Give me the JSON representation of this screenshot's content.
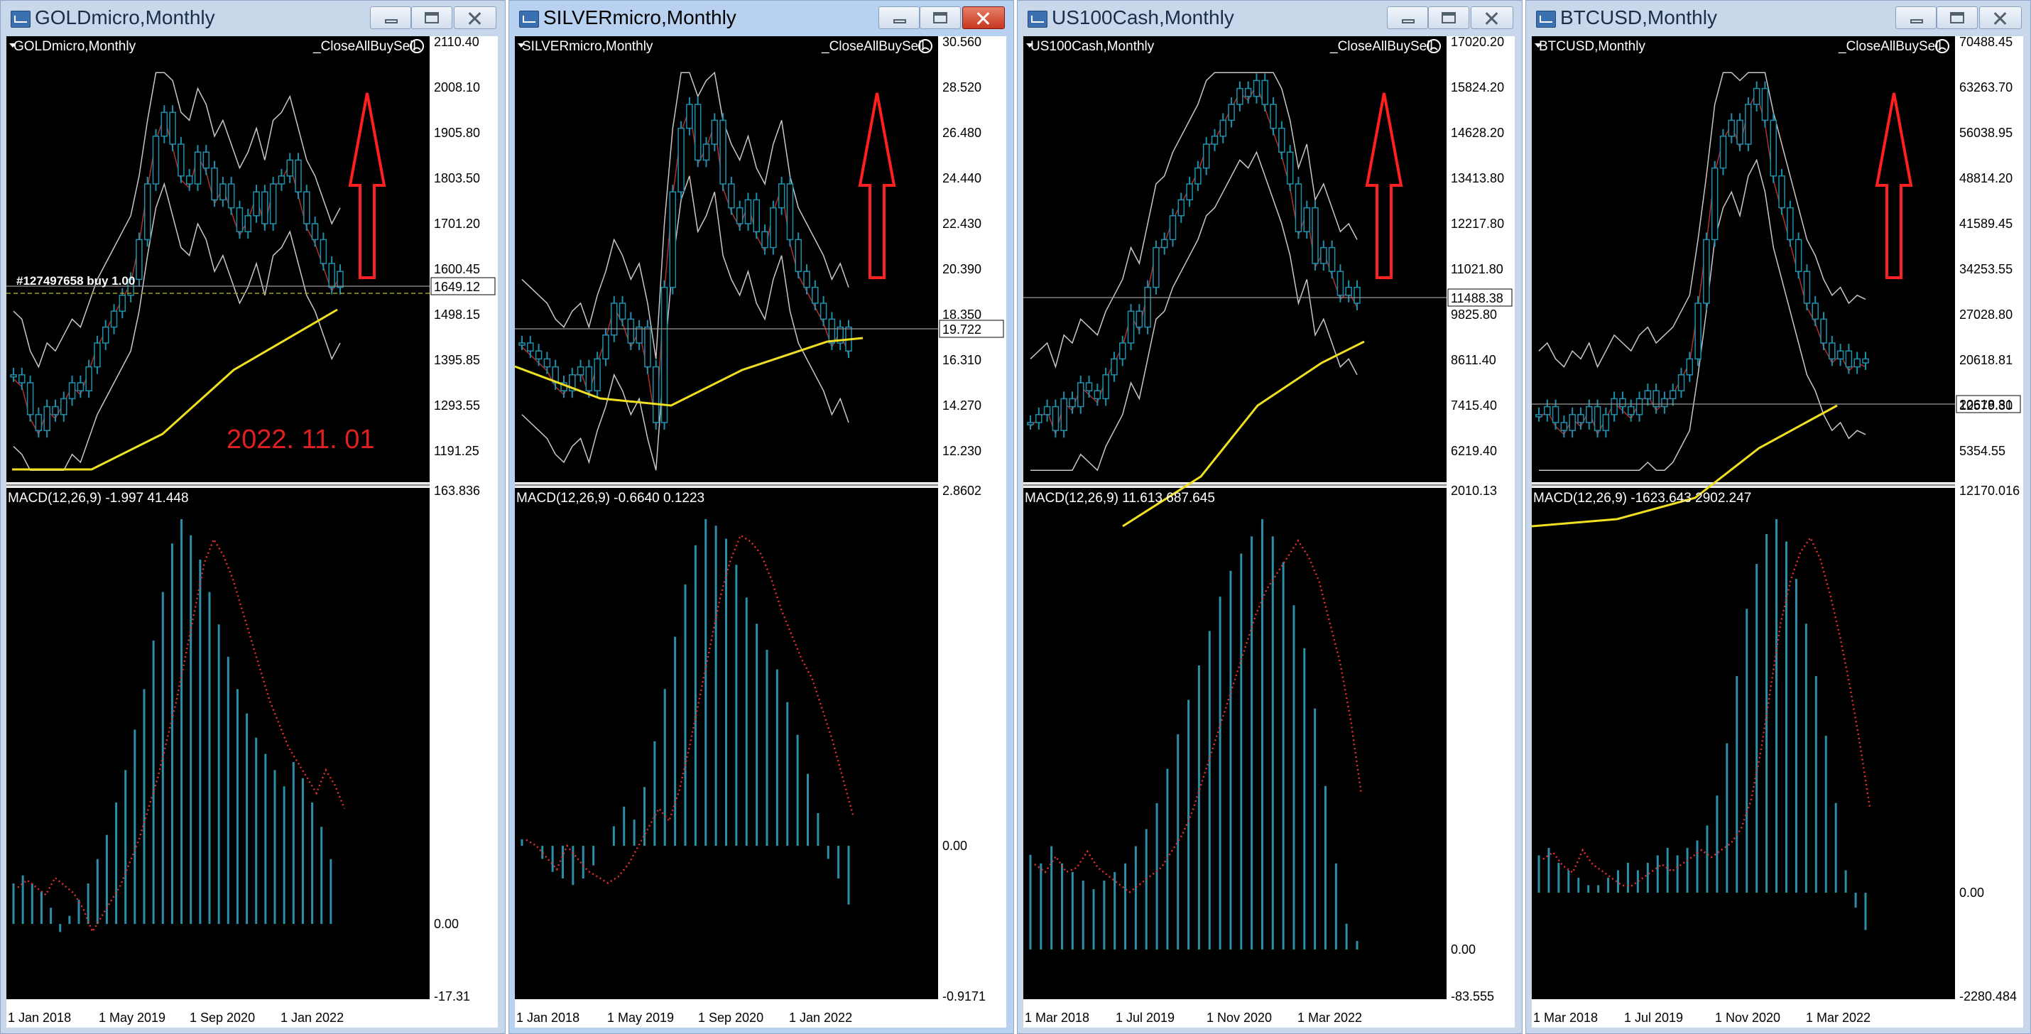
{
  "windows": [
    {
      "title": "GOLDmicro,Monthly",
      "active": false,
      "chart_label": "GOLDmicro,Monthly",
      "expert": "_CloseAllBuySell",
      "price_axis": [
        "2110.40",
        "2008.10",
        "1905.80",
        "1803.50",
        "1701.20",
        "1600.45",
        "1498.15",
        "1395.85",
        "1293.55",
        "1191.25"
      ],
      "current_price": "1649.12",
      "order_label": "#127497658 buy 1.00",
      "macd_label": "MACD(12,26,9) -1.997 41.448",
      "macd_axis": {
        "top": "163.836",
        "zero": "0.00",
        "bottom": "-17.31"
      },
      "date_axis": [
        "1 Jan 2018",
        "1 May 2019",
        "1 Sep 2020",
        "1 Jan 2022"
      ],
      "watermark": "2022. 11. 01"
    },
    {
      "title": "SILVERmicro,Monthly",
      "active": true,
      "chart_label": "SILVERmicro,Monthly",
      "expert": "_CloseAllBuySell",
      "price_axis": [
        "30.560",
        "28.520",
        "26.480",
        "24.440",
        "22.430",
        "20.390",
        "18.350",
        "16.310",
        "14.270",
        "12.230"
      ],
      "current_price": "19.722",
      "order_label": "",
      "macd_label": "MACD(12,26,9) -0.6640 0.1223",
      "macd_axis": {
        "top": "2.8602",
        "zero": "0.00",
        "bottom": "-0.9171"
      },
      "date_axis": [
        "1 Jan 2018",
        "1 May 2019",
        "1 Sep 2020",
        "1 Jan 2022"
      ],
      "watermark": ""
    },
    {
      "title": "US100Cash,Monthly",
      "active": false,
      "chart_label": "US100Cash,Monthly",
      "expert": "_CloseAllBuySell",
      "price_axis": [
        "17020.20",
        "15824.20",
        "14628.20",
        "13413.80",
        "12217.80",
        "11021.80",
        "9825.80",
        "8611.40",
        "7415.40",
        "6219.40"
      ],
      "current_price": "11488.38",
      "order_label": "",
      "macd_label": "MACD(12,26,9) 11.613 687.645",
      "macd_axis": {
        "top": "2010.13",
        "zero": "0.00",
        "bottom": "-83.555"
      },
      "date_axis": [
        "1 Mar 2018",
        "1 Jul 2019",
        "1 Nov 2020",
        "1 Mar 2022"
      ],
      "watermark": ""
    },
    {
      "title": "BTCUSD,Monthly",
      "active": false,
      "chart_label": "BTCUSD,Monthly",
      "expert": "_CloseAllBuySell",
      "price_axis": [
        "70488.45",
        "63263.70",
        "56038.95",
        "48814.20",
        "41589.45",
        "34253.55",
        "27028.80",
        "20618.81",
        "12579.30",
        "5354.55"
      ],
      "current_price": "20618.81",
      "order_label": "",
      "macd_label": "MACD(12,26,9) -1623.643 2902.247",
      "macd_axis": {
        "top": "12170.016",
        "zero": "0.00",
        "bottom": "-2280.484"
      },
      "date_axis": [
        "1 Mar 2018",
        "1 Jul 2019",
        "1 Nov 2020",
        "1 Mar 2022"
      ],
      "watermark": ""
    }
  ],
  "colors": {
    "background": "#000000",
    "grid": "#3a3a3a",
    "axis_text": "#ffffff",
    "macd_bars": "#2a8fa8",
    "signal_line": "#e03030",
    "moving_average": "#f0e020",
    "bollinger": "#c8c8c8",
    "candle": "#1e8faa",
    "arrow": "#ff2020",
    "watermark": "#e02020"
  }
}
